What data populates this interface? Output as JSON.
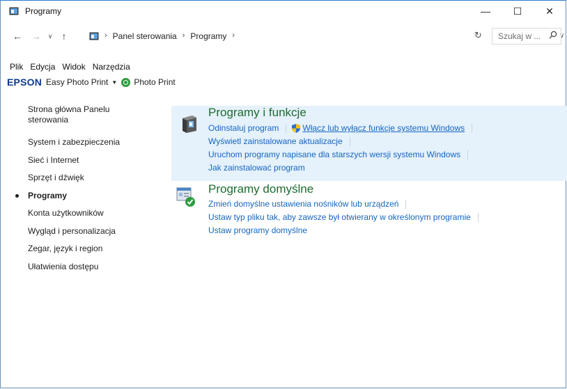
{
  "window": {
    "title": "Programy",
    "controls": {
      "minimize": "—",
      "maximize": "☐",
      "close": "✕"
    }
  },
  "nav": {
    "back": "←",
    "forward": "→",
    "recent": "∨",
    "up": "↑",
    "breadcrumbs": [
      "Panel sterowania",
      "Programy"
    ],
    "crumb_sep": "›",
    "dropdown": "∨",
    "refresh": "↻",
    "search_placeholder": "Szukaj w ...",
    "search_icon": "⚲"
  },
  "menu": [
    "Plik",
    "Edycja",
    "Widok",
    "Narzędzia"
  ],
  "epson": {
    "logo": "EPSON",
    "easy": "Easy Photo Print",
    "caret": "▼",
    "photo_print": "Photo Print"
  },
  "sidebar": {
    "home": "Strona główna Panelu sterowania",
    "items": [
      {
        "label": "System i zabezpieczenia",
        "active": false
      },
      {
        "label": "Sieć i Internet",
        "active": false
      },
      {
        "label": "Sprzęt i dźwięk",
        "active": false
      },
      {
        "label": "Programy",
        "active": true
      },
      {
        "label": "Konta użytkowników",
        "active": false
      },
      {
        "label": "Wygląd i personalizacja",
        "active": false
      },
      {
        "label": "Zegar, język i region",
        "active": false
      },
      {
        "label": "Ułatwienia dostępu",
        "active": false
      }
    ]
  },
  "sections": {
    "programs": {
      "title": "Programy i funkcje",
      "uninstall": "Odinstaluj program",
      "win_features": "Włącz lub wyłącz funkcje systemu Windows",
      "updates": "Wyświetl zainstalowane aktualizacje",
      "compat": "Uruchom programy napisane dla starszych wersji systemu Windows",
      "howto": "Jak zainstalować program"
    },
    "defaults": {
      "title": "Programy domyślne",
      "autoplay": "Zmień domyślne ustawienia nośników lub urządzeń",
      "filetype": "Ustaw typ pliku tak, aby zawsze był otwierany w określonym programie",
      "setdefault": "Ustaw programy domyślne"
    }
  },
  "colors": {
    "accent_link": "#1566c0",
    "section_title": "#1e6b2f",
    "highlight_bg": "#e5f1fb"
  }
}
